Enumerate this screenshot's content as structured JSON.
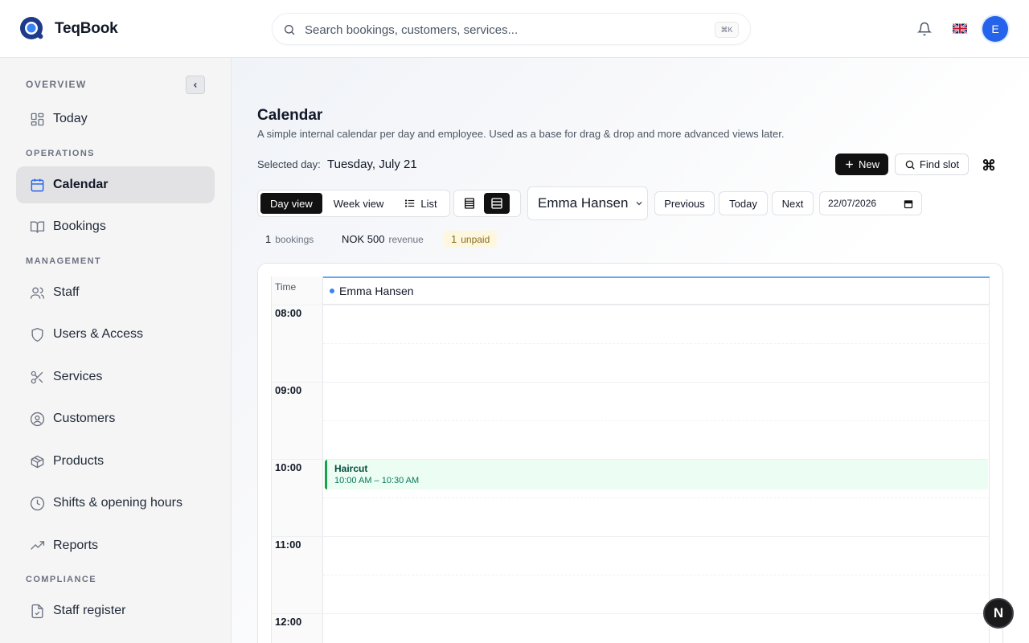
{
  "app": {
    "brand": "TeqBook"
  },
  "search": {
    "placeholder": "Search bookings, customers, services...",
    "shortcut": "⌘K"
  },
  "header": {
    "avatar_initial": "E"
  },
  "sidebar": {
    "sections": [
      {
        "label": "OVERVIEW"
      },
      {
        "label": "OPERATIONS"
      },
      {
        "label": "MANAGEMENT"
      },
      {
        "label": "COMPLIANCE"
      }
    ],
    "items": [
      {
        "label": "Today",
        "icon": "grid-icon"
      },
      {
        "label": "Calendar",
        "icon": "calendar-icon",
        "active": true
      },
      {
        "label": "Bookings",
        "icon": "book-icon"
      },
      {
        "label": "Staff",
        "icon": "users-icon"
      },
      {
        "label": "Users & Access",
        "icon": "shield-icon"
      },
      {
        "label": "Services",
        "icon": "scissors-icon"
      },
      {
        "label": "Customers",
        "icon": "user-circle-icon"
      },
      {
        "label": "Products",
        "icon": "box-icon"
      },
      {
        "label": "Shifts & opening hours",
        "icon": "clock-icon"
      },
      {
        "label": "Reports",
        "icon": "trend-icon"
      },
      {
        "label": "Staff register",
        "icon": "file-check-icon"
      }
    ]
  },
  "page": {
    "title": "Calendar",
    "subtitle": "A simple internal calendar per day and employee. Used as a base for drag & drop and more advanced views later.",
    "selected_label": "Selected day:",
    "selected_value": "Tuesday, July 21"
  },
  "toolbar": {
    "new_label": "New",
    "find_slot_label": "Find slot",
    "views": [
      "Day view",
      "Week view",
      "List"
    ],
    "active_view": "Day view",
    "employee": "Emma Hansen",
    "previous_label": "Previous",
    "today_label": "Today",
    "next_label": "Next",
    "date_value": "22/07/2026"
  },
  "stats": {
    "bookings_count": "1",
    "bookings_label": "bookings",
    "revenue_value": "NOK 500",
    "revenue_label": "revenue",
    "unpaid_count": "1",
    "unpaid_label": "unpaid"
  },
  "calendar": {
    "time_header": "Time",
    "employee_column": "Emma Hansen",
    "hours": [
      "08:00",
      "09:00",
      "10:00",
      "11:00",
      "12:00"
    ],
    "events": [
      {
        "title": "Haircut",
        "range": "10:00 AM – 10:30 AM"
      }
    ]
  },
  "fab": {
    "label": "N"
  }
}
